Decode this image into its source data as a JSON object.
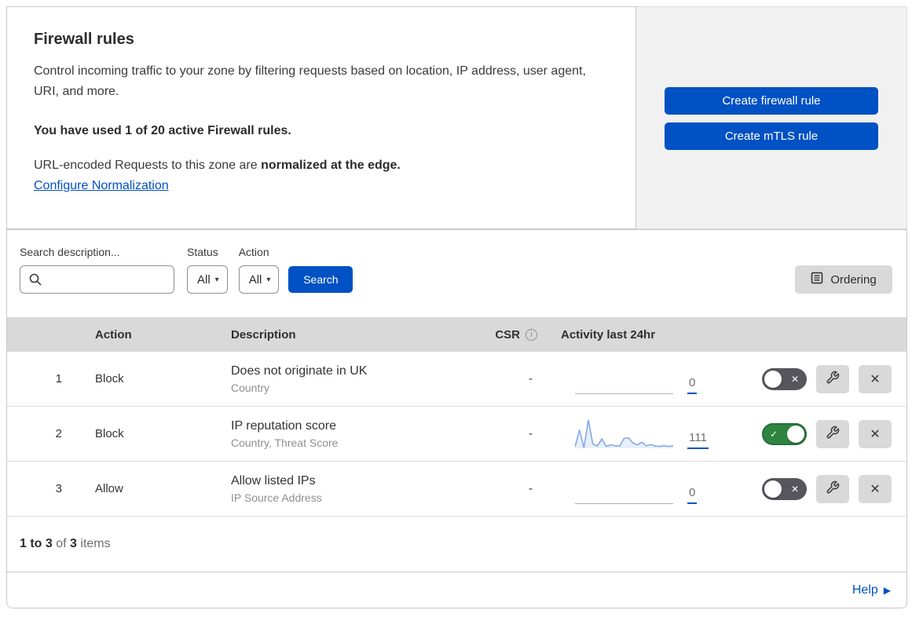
{
  "intro": {
    "title": "Firewall rules",
    "description": "Control incoming traffic to your zone by filtering requests based on location, IP address, user agent, URI, and more.",
    "usage": "You have used 1 of 20 active Firewall rules.",
    "normalization_text": "URL-encoded Requests to this zone are ",
    "normalization_bold": "normalized at the edge.",
    "normalization_link": "Configure Normalization"
  },
  "cta": {
    "create_firewall": "Create firewall rule",
    "create_mtls": "Create mTLS rule"
  },
  "filters": {
    "search_label": "Search description...",
    "status_label": "Status",
    "status_value": "All",
    "action_label": "Action",
    "action_value": "All",
    "search_button": "Search",
    "ordering_button": "Ordering"
  },
  "table": {
    "headers": {
      "action": "Action",
      "description": "Description",
      "csr": "CSR",
      "activity": "Activity last 24hr"
    },
    "rows": [
      {
        "priority": "1",
        "action": "Block",
        "title": "Does not originate in UK",
        "fields": "Country",
        "csr": "-",
        "count": "0",
        "enabled": false,
        "sparkline": []
      },
      {
        "priority": "2",
        "action": "Block",
        "title": "IP reputation score",
        "fields": "Country, Threat Score",
        "csr": "-",
        "count": "111",
        "enabled": true,
        "sparkline": [
          5,
          65,
          2,
          100,
          15,
          8,
          33,
          7,
          12,
          9,
          8,
          35,
          37,
          18,
          12,
          21,
          9,
          13,
          8,
          7,
          9,
          7,
          8
        ]
      },
      {
        "priority": "3",
        "action": "Allow",
        "title": "Allow listed IPs",
        "fields": "IP Source Address",
        "csr": "-",
        "count": "0",
        "enabled": false,
        "sparkline": []
      }
    ]
  },
  "footer": {
    "range": "1 to 3",
    "of": " of ",
    "total": "3",
    "items": " items"
  },
  "help": {
    "label": "Help"
  },
  "icons": {
    "info": "i",
    "dropdown_caret": "▾",
    "close": "✕",
    "toggle_on": "✓",
    "toggle_off": "✕",
    "help_arrow": "▶"
  },
  "colors": {
    "primary_blue": "#0051c3",
    "toggle_on_green": "#2e8540",
    "toggle_off_gray": "#56565c",
    "sparkline_blue": "#7da5e8",
    "table_header_bg": "#d9d9d9",
    "panel_bg": "#f1f1f1"
  }
}
